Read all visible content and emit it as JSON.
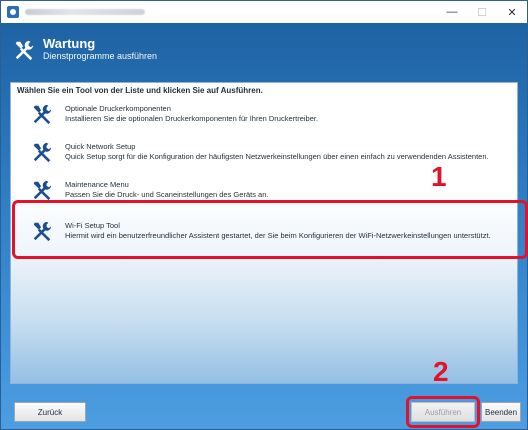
{
  "window": {
    "controls": {
      "minimize": "—",
      "maximize": "☐",
      "close": "✕"
    }
  },
  "header": {
    "title": "Wartung",
    "subtitle": "Dienstprogramme ausführen",
    "icon": "tools-icon"
  },
  "instruction": "Wählen Sie ein Tool von der Liste und klicken Sie auf Ausführen.",
  "tools": [
    {
      "name": "Optionale Druckerkomponenten",
      "description": "Installieren Sie die optionalen Druckerkomponenten für Ihren Druckertreiber.",
      "icon": "tools-icon"
    },
    {
      "name": "Quick Network Setup",
      "description": "Quick Setup sorgt für die Konfiguration der häufigsten Netzwerkeinstellungen über einen einfach zu verwendenden Assistenten.",
      "icon": "tools-icon"
    },
    {
      "name": "Maintenance Menu",
      "description": "Passen Sie die Druck- und Scaneinstellungen des Geräts an.",
      "icon": "tools-icon"
    },
    {
      "name": "Wi-Fi Setup Tool",
      "description": "Hiermit wird ein benutzerfreundlicher Assistent gestartet, der Sie beim Konfigurieren der WiFi-Netzwerkeinstellungen unterstützt.",
      "icon": "tools-icon"
    }
  ],
  "callouts": {
    "one": "1",
    "two": "2"
  },
  "buttons": {
    "back": "Zurück",
    "run": "Ausführen",
    "exit": "Beenden"
  },
  "colors": {
    "accent": "#2f7dc4",
    "highlight": "#e3122b",
    "icon": "#1a4f8f"
  }
}
